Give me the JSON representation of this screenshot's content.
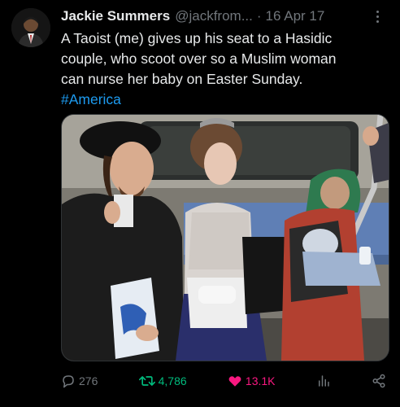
{
  "tweet": {
    "author_name": "Jackie Summers",
    "handle": "@jackfrom...",
    "separator": "·",
    "date": "16 Apr 17",
    "text_lines": [
      "A Taoist (me) gives up his seat to a Hasidic",
      "couple, who scoot over so a Muslim woman",
      "can nurse her baby on Easter Sunday."
    ],
    "hashtag": "#America"
  },
  "actions": {
    "replies": "276",
    "retweets": "4,786",
    "likes": "13.1K"
  },
  "colors": {
    "background": "#000000",
    "primary_text": "#e7e9ea",
    "secondary_text": "#71767b",
    "link": "#1d9bf0",
    "retweet": "#00ba7c",
    "like": "#f91880"
  },
  "icons": [
    "more-icon",
    "reply-icon",
    "retweet-icon",
    "like-icon",
    "views-icon",
    "share-icon"
  ]
}
